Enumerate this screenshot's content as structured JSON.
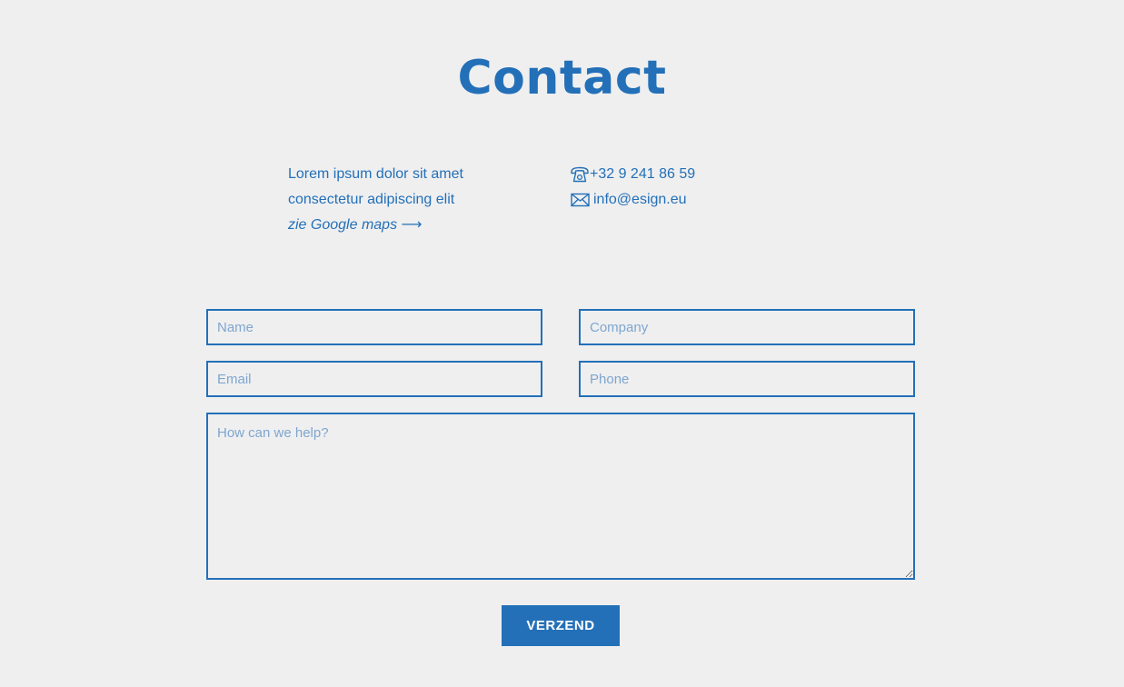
{
  "header": {
    "title": "Contact"
  },
  "address": {
    "line1": "Lorem ipsum dolor sit amet",
    "line2": "consectetur adipiscing elit",
    "maps_link": "zie Google maps ⟶"
  },
  "contact": {
    "phone": "+32 9 241 86 59",
    "phone_icon": "phone-icon",
    "email": "info@esign.eu",
    "email_icon": "envelope-icon"
  },
  "form": {
    "name_placeholder": "Name",
    "name_value": "",
    "company_placeholder": "Company",
    "company_value": "",
    "email_placeholder": "Email",
    "email_value": "",
    "phone_placeholder": "Phone",
    "phone_value": "",
    "message_placeholder": "How can we help?",
    "message_value": "",
    "submit_label": "VERZEND"
  },
  "colors": {
    "accent": "#2370b8",
    "background": "#efeff0",
    "placeholder": "#7fa6cf",
    "button_text": "#ffffff"
  }
}
